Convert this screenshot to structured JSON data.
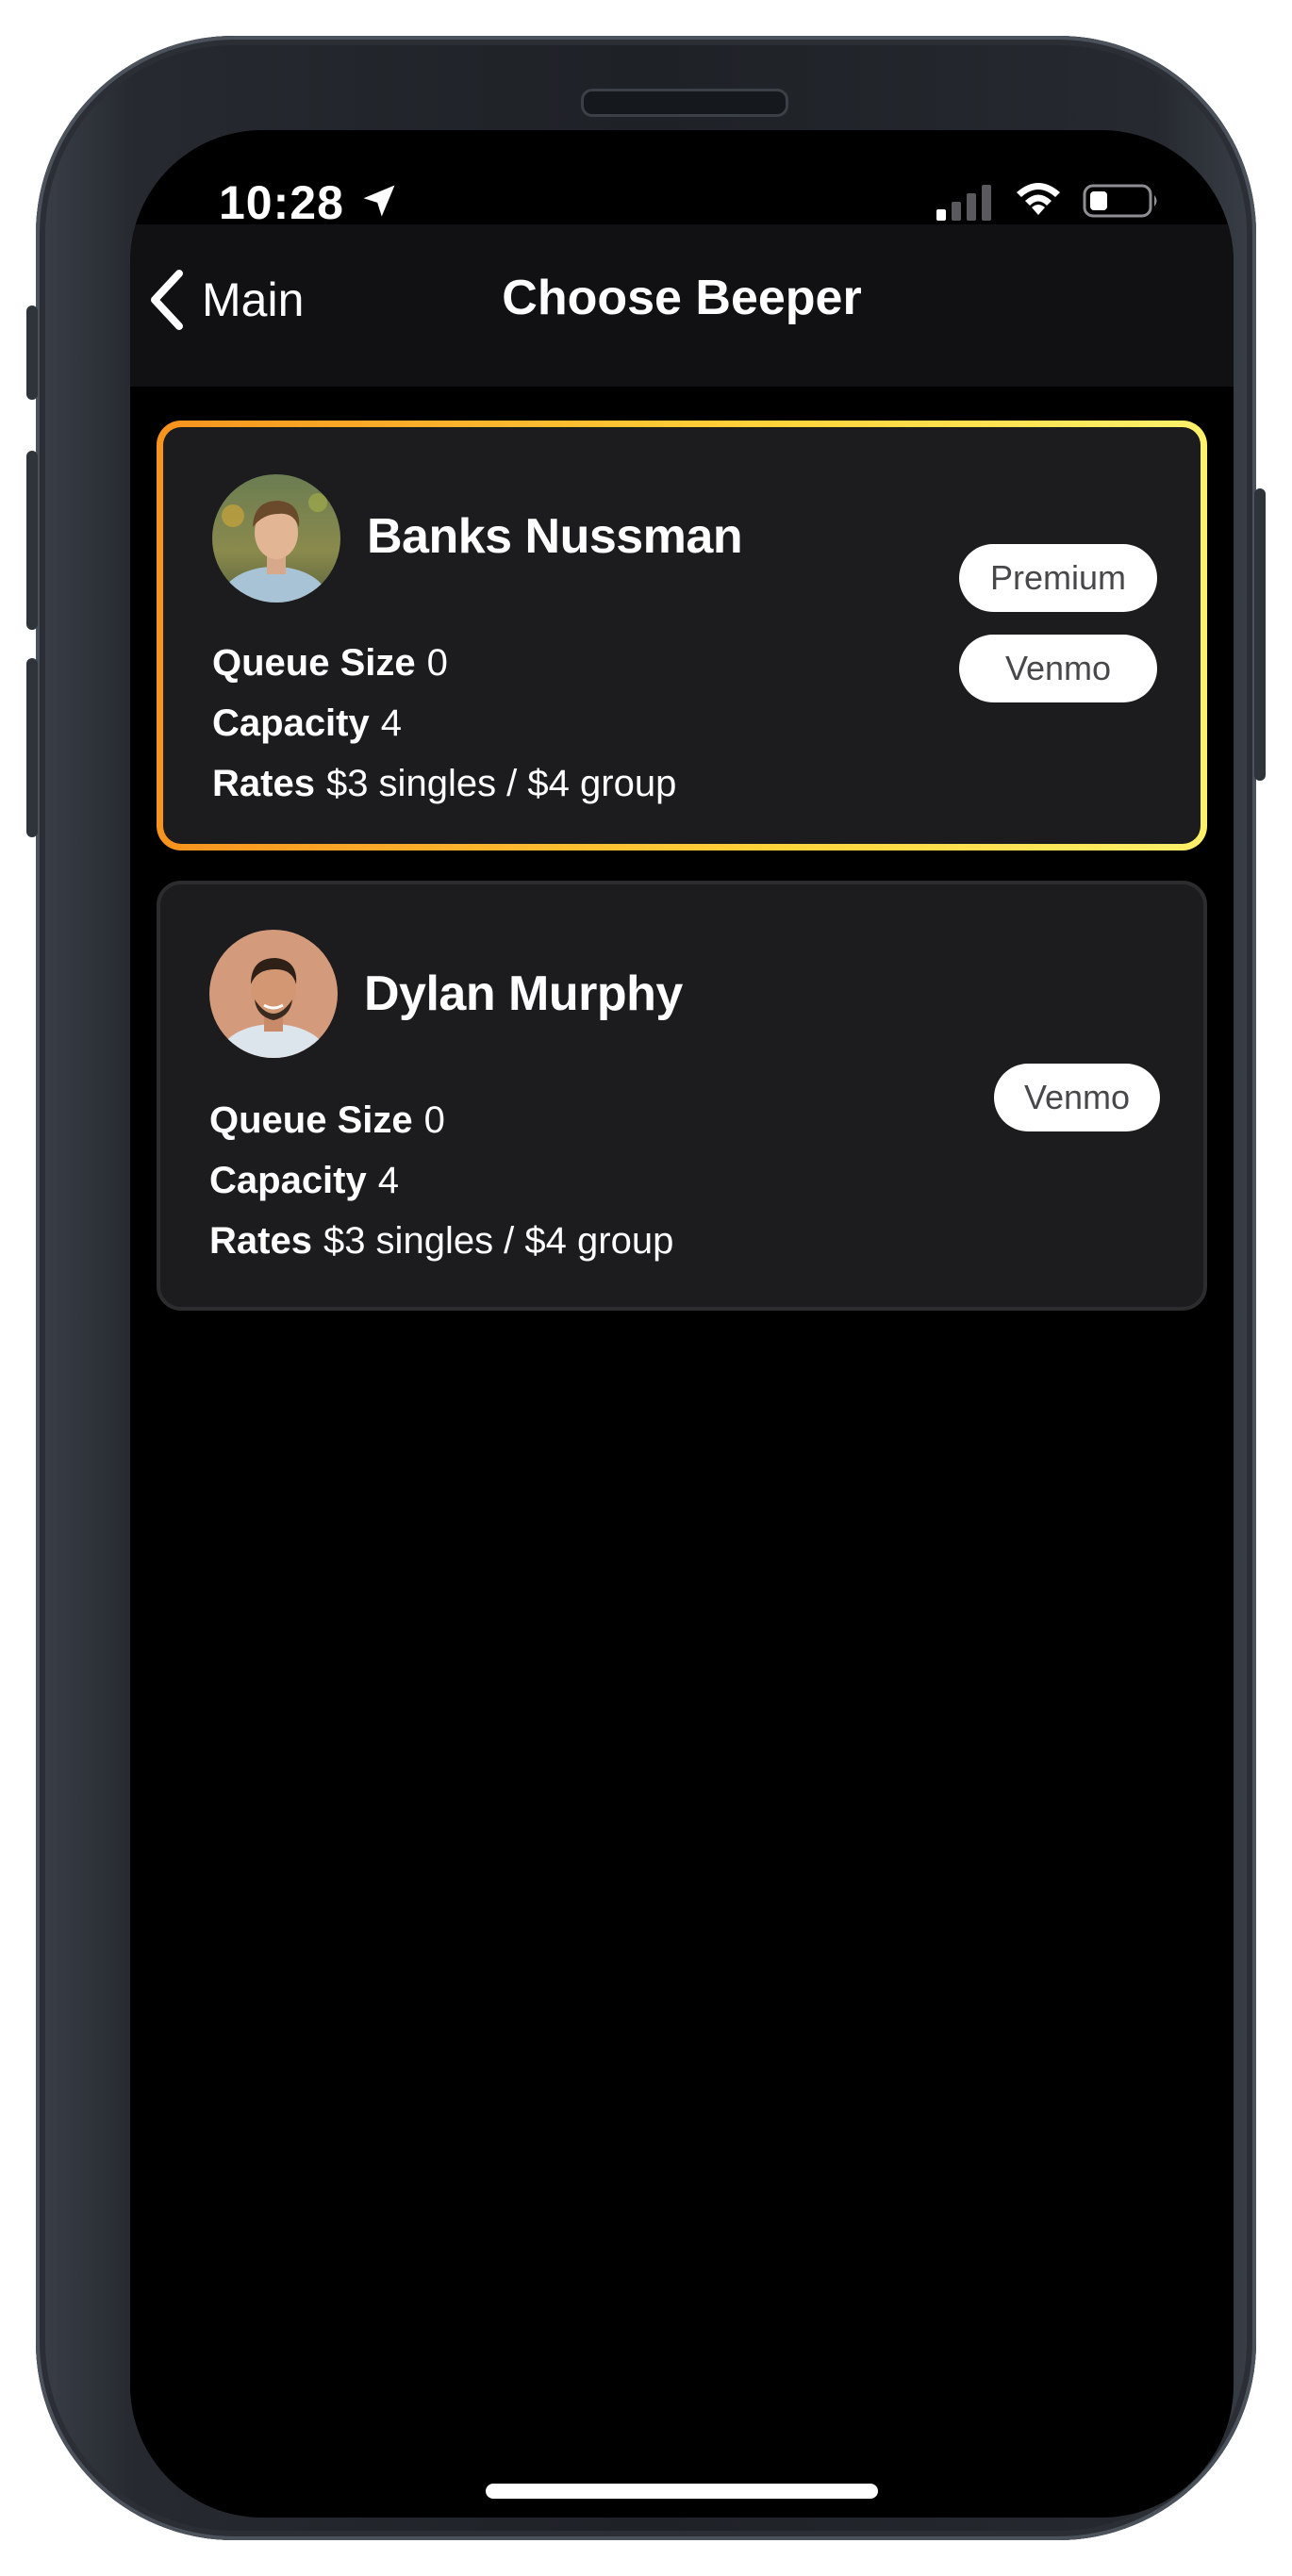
{
  "status_bar": {
    "time": "10:28",
    "icons": [
      "location-arrow-icon",
      "cellular-signal-icon",
      "wifi-icon",
      "battery-icon"
    ]
  },
  "nav": {
    "back_label": "Main",
    "title": "Choose Beeper"
  },
  "labels": {
    "queue_size": "Queue Size",
    "capacity": "Capacity",
    "rates": "Rates"
  },
  "beepers": [
    {
      "name": "Banks Nussman",
      "queue_size": "0",
      "capacity": "4",
      "rates": "$3 singles / $4 group",
      "badges": [
        "Premium",
        "Venmo"
      ],
      "premium": true
    },
    {
      "name": "Dylan Murphy",
      "queue_size": "0",
      "capacity": "4",
      "rates": "$3 singles / $4 group",
      "badges": [
        "Venmo"
      ],
      "premium": false
    }
  ],
  "colors": {
    "background": "#000000",
    "nav_bar": "#111113",
    "card": "#1c1c1e",
    "premium_border_start": "#f7931e",
    "premium_border_end": "#fff06a",
    "badge_bg": "#ffffff",
    "badge_text": "#48484a"
  }
}
